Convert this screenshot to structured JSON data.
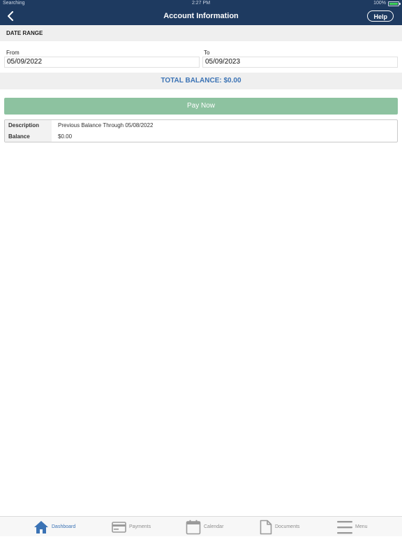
{
  "status_bar": {
    "carrier": "Searching",
    "time": "2:27 PM",
    "battery": "100%"
  },
  "nav": {
    "title": "Account Information",
    "help_label": "Help"
  },
  "date_range": {
    "header": "DATE RANGE",
    "from_label": "From",
    "from_value": "05/09/2022",
    "to_label": "To",
    "to_value": "05/09/2023"
  },
  "total_balance": "TOTAL BALANCE: $0.00",
  "pay_now_label": "Pay Now",
  "balance_card": {
    "description_label": "Description",
    "description_value": "Previous Balance Through 05/08/2022",
    "balance_label": "Balance",
    "balance_value": "$0.00"
  },
  "tabs": [
    {
      "label": "Dashboard",
      "icon": "home-icon",
      "active": true
    },
    {
      "label": "Payments",
      "icon": "credit-card-icon",
      "active": false
    },
    {
      "label": "Calendar",
      "icon": "calendar-icon",
      "active": false
    },
    {
      "label": "Documents",
      "icon": "document-icon",
      "active": false
    },
    {
      "label": "Menu",
      "icon": "hamburger-menu-icon",
      "active": false
    }
  ],
  "colors": {
    "header_bg": "#1e3a60",
    "accent_blue": "#3b73b5",
    "pay_now_green": "#8dc2a0",
    "battery_green": "#3ecf5a"
  }
}
